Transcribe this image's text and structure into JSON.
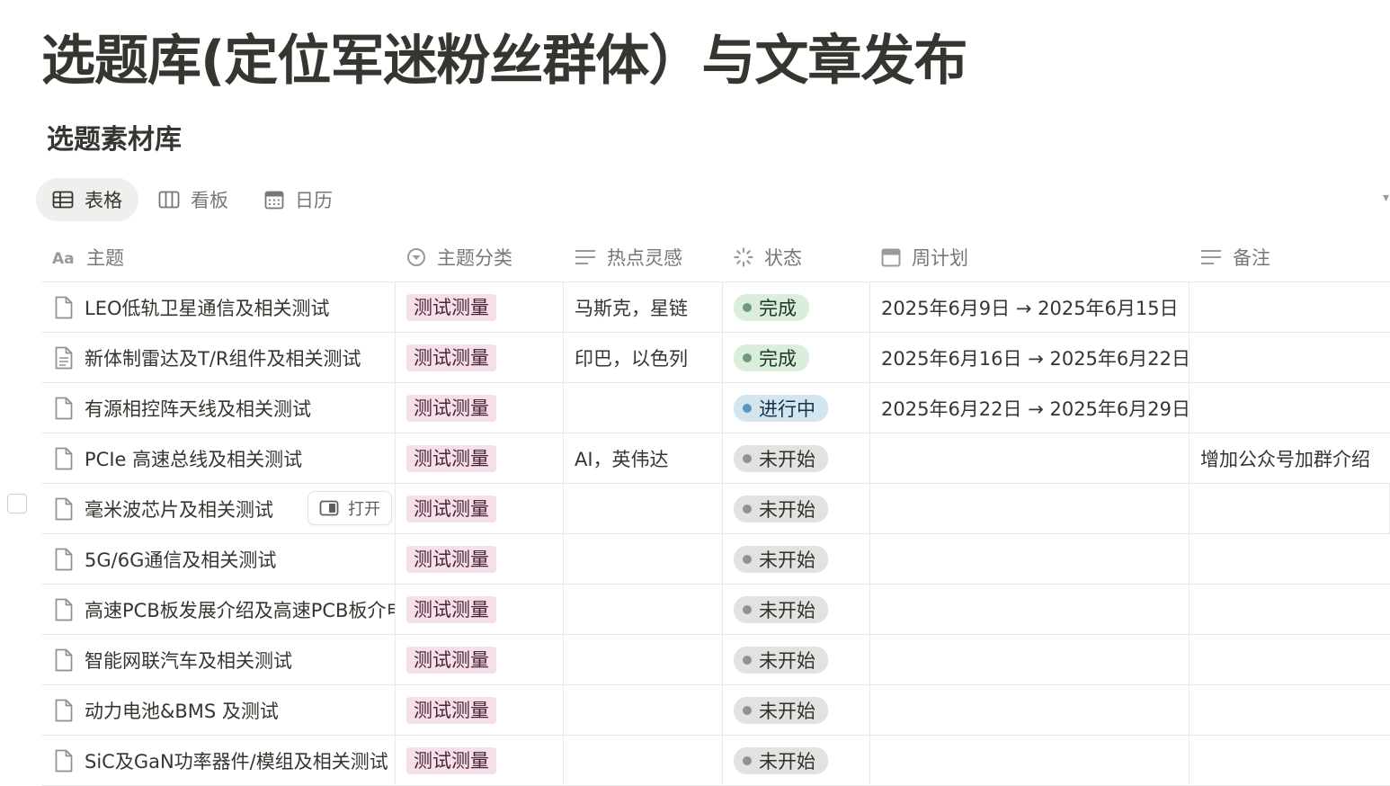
{
  "page": {
    "title": "选题库(定位军迷粉丝群体）与文章发布"
  },
  "database": {
    "title": "选题素材库",
    "views": [
      {
        "label": "表格",
        "icon": "table-icon",
        "active": true
      },
      {
        "label": "看板",
        "icon": "board-icon",
        "active": false
      },
      {
        "label": "日历",
        "icon": "calendar-icon",
        "active": false
      }
    ]
  },
  "table": {
    "columns": [
      {
        "label": "主题",
        "icon": "text-type-icon"
      },
      {
        "label": "主题分类",
        "icon": "select-icon"
      },
      {
        "label": "热点灵感",
        "icon": "lines-icon"
      },
      {
        "label": "状态",
        "icon": "status-icon"
      },
      {
        "label": "周计划",
        "icon": "calendar-icon"
      },
      {
        "label": "备注",
        "icon": "lines-icon"
      }
    ],
    "rows": [
      {
        "title": "LEO低轨卫星通信及相关测试",
        "category": "测试测量",
        "hot": "马斯克，星链",
        "status": "完成",
        "week": "2025年6月9日 → 2025年6月15日",
        "note": ""
      },
      {
        "title": "新体制雷达及T/R组件及相关测试",
        "category": "测试测量",
        "hot": "印巴，以色列",
        "status": "完成",
        "week": "2025年6月16日 → 2025年6月22日",
        "note": ""
      },
      {
        "title": "有源相控阵天线及相关测试",
        "category": "测试测量",
        "hot": "",
        "status": "进行中",
        "week": "2025年6月22日 → 2025年6月29日",
        "note": ""
      },
      {
        "title": "PCIe 高速总线及相关测试",
        "category": "测试测量",
        "hot": "AI，英伟达",
        "status": "未开始",
        "week": "",
        "note": "增加公众号加群介绍"
      },
      {
        "title": "毫米波芯片及相关测试",
        "category": "测试测量",
        "hot": "",
        "status": "未开始",
        "week": "",
        "note": ""
      },
      {
        "title": "5G/6G通信及相关测试",
        "category": "测试测量",
        "hot": "",
        "status": "未开始",
        "week": "",
        "note": ""
      },
      {
        "title": "高速PCB板发展介绍及高速PCB板介电",
        "category": "测试测量",
        "hot": "",
        "status": "未开始",
        "week": "",
        "note": ""
      },
      {
        "title": "智能网联汽车及相关测试",
        "category": "测试测量",
        "hot": "",
        "status": "未开始",
        "week": "",
        "note": ""
      },
      {
        "title": "动力电池&BMS 及测试",
        "category": "测试测量",
        "hot": "",
        "status": "未开始",
        "week": "",
        "note": ""
      },
      {
        "title": "SiC及GaN功率器件/模组及相关测试",
        "category": "测试测量",
        "hot": "",
        "status": "未开始",
        "week": "",
        "note": ""
      }
    ],
    "hover_action": {
      "label": "打开",
      "row": 4
    }
  },
  "colors": {
    "tag_bg": "#f5e0e9",
    "done": "#dbeddb",
    "in_progress": "#d3e5ef",
    "not_started": "#e3e2e0"
  }
}
